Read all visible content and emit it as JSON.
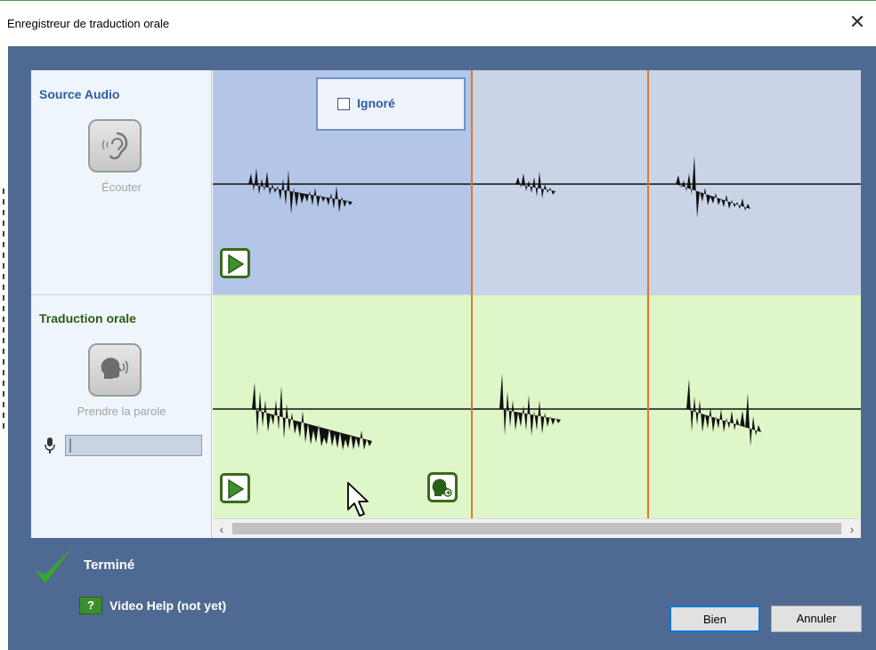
{
  "window": {
    "title": "Enregistreur de traduction orale"
  },
  "source": {
    "title": "Source Audio",
    "listen_label": "Écouter",
    "ignore_label": "Ignoré",
    "ignore_checked": false
  },
  "translation": {
    "title": "Traduction orale",
    "speak_label": "Prendre la parole"
  },
  "status": {
    "done_label": "Terminé"
  },
  "help": {
    "video_help_label": "Video Help (not yet)",
    "icon_text": "?"
  },
  "buttons": {
    "ok_label": "Bien",
    "cancel_label": "Annuler"
  },
  "colors": {
    "dialog_bg": "#4f6a92",
    "source_selected": "#b4c6e7",
    "source_other": "#c9d4e7",
    "translation_bg": "#dff6c8",
    "segment_line": "#e0782e",
    "accent_green": "#3a6a1a"
  }
}
